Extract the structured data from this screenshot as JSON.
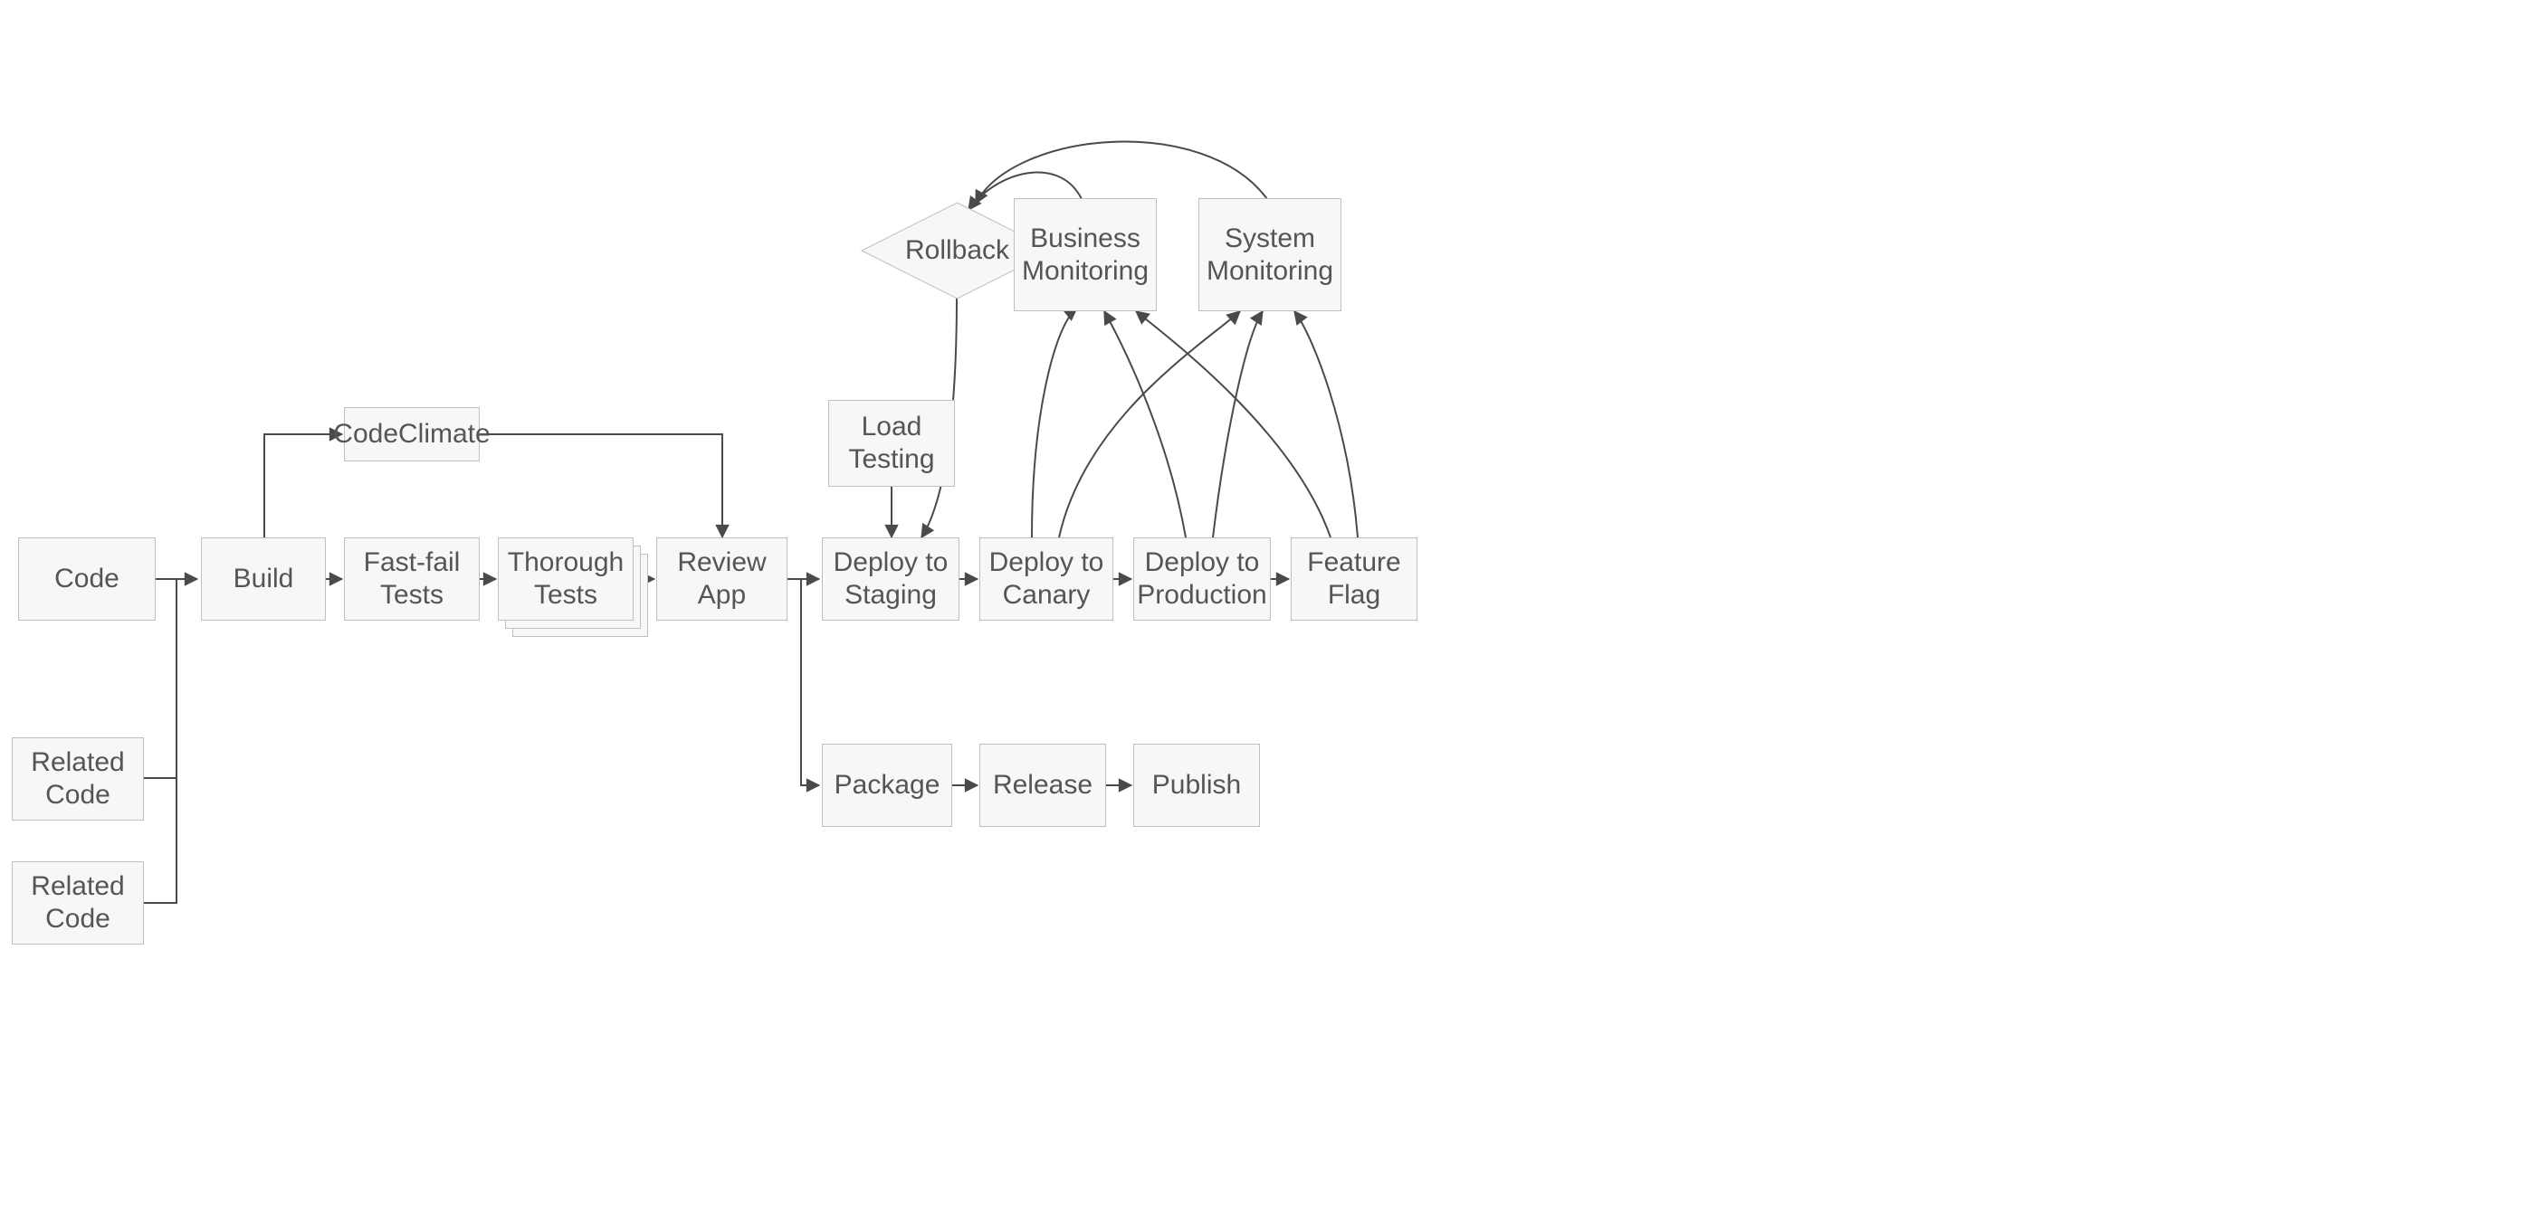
{
  "colors": {
    "node_fill": "#f7f7f7",
    "node_stroke": "#bfbfbf",
    "text": "#555555",
    "edge": "#4a4a4a"
  },
  "nodes": {
    "code": "Code",
    "related_code_1": "Related Code",
    "related_code_2": "Related Code",
    "build": "Build",
    "codeclimate": "CodeClimate",
    "fast_fail_tests": "Fast-fail Tests",
    "thorough_tests": "Thorough Tests",
    "review_app": "Review App",
    "load_testing": "Load Testing",
    "rollback": "Rollback",
    "deploy_staging": "Deploy to Staging",
    "deploy_canary": "Deploy to Canary",
    "deploy_production": "Deploy to Production",
    "feature_flag": "Feature Flag",
    "business_monitoring": "Business Monitoring",
    "system_monitoring": "System Monitoring",
    "package": "Package",
    "release": "Release",
    "publish": "Publish"
  },
  "edges": [
    {
      "from": "code",
      "to": "build"
    },
    {
      "from": "related_code_1",
      "to": "build",
      "style": "elbow"
    },
    {
      "from": "related_code_2",
      "to": "build",
      "style": "elbow"
    },
    {
      "from": "build",
      "to": "codeclimate",
      "style": "up-right"
    },
    {
      "from": "build",
      "to": "fast_fail_tests"
    },
    {
      "from": "fast_fail_tests",
      "to": "thorough_tests"
    },
    {
      "from": "codeclimate",
      "to": "review_app",
      "style": "right-down"
    },
    {
      "from": "thorough_tests",
      "to": "review_app"
    },
    {
      "from": "review_app",
      "to": "deploy_staging"
    },
    {
      "from": "review_app",
      "to": "package",
      "style": "right-down-right"
    },
    {
      "from": "load_testing",
      "to": "deploy_staging",
      "style": "down"
    },
    {
      "from": "rollback",
      "to": "deploy_staging",
      "style": "curve-down"
    },
    {
      "from": "deploy_staging",
      "to": "deploy_canary"
    },
    {
      "from": "deploy_canary",
      "to": "deploy_production"
    },
    {
      "from": "deploy_production",
      "to": "feature_flag"
    },
    {
      "from": "deploy_canary",
      "to": "business_monitoring",
      "style": "curve-up"
    },
    {
      "from": "deploy_canary",
      "to": "system_monitoring",
      "style": "curve-up"
    },
    {
      "from": "deploy_production",
      "to": "business_monitoring",
      "style": "curve-up"
    },
    {
      "from": "deploy_production",
      "to": "system_monitoring",
      "style": "curve-up"
    },
    {
      "from": "feature_flag",
      "to": "business_monitoring",
      "style": "curve-up"
    },
    {
      "from": "feature_flag",
      "to": "system_monitoring",
      "style": "curve-up"
    },
    {
      "from": "business_monitoring",
      "to": "rollback",
      "style": "curve-left"
    },
    {
      "from": "system_monitoring",
      "to": "rollback",
      "style": "curve-left"
    },
    {
      "from": "package",
      "to": "release"
    },
    {
      "from": "release",
      "to": "publish"
    }
  ]
}
